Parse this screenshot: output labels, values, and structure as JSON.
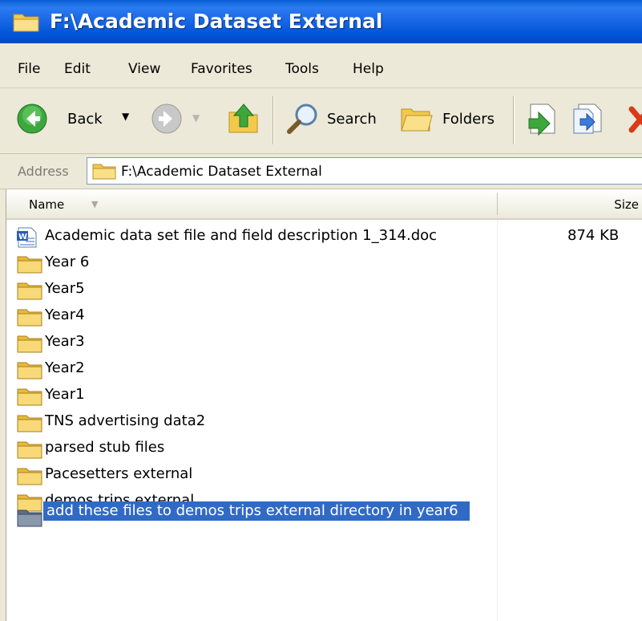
{
  "window": {
    "title": "F:\\Academic Dataset External",
    "icon": "folder-icon"
  },
  "menu": {
    "items": [
      "File",
      "Edit",
      "View",
      "Favorites",
      "Tools",
      "Help"
    ]
  },
  "toolbar": {
    "back_label": "Back",
    "search_label": "Search",
    "folders_label": "Folders",
    "icons": [
      "back-arrow-icon",
      "forward-arrow-icon",
      "up-folder-icon",
      "search-icon",
      "folders-icon",
      "move-to-icon",
      "copy-to-icon",
      "delete-icon"
    ]
  },
  "address": {
    "label": "Address",
    "value": "F:\\Academic Dataset External"
  },
  "list": {
    "columns": {
      "name": "Name",
      "size": "Size"
    },
    "items": [
      {
        "name": "Academic data set file and field description 1_314.doc",
        "size": "874 KB",
        "type": "word-doc"
      },
      {
        "name": "Year 6",
        "size": "",
        "type": "folder"
      },
      {
        "name": "Year5",
        "size": "",
        "type": "folder"
      },
      {
        "name": "Year4",
        "size": "",
        "type": "folder"
      },
      {
        "name": "Year3",
        "size": "",
        "type": "folder"
      },
      {
        "name": "Year2",
        "size": "",
        "type": "folder"
      },
      {
        "name": "Year1",
        "size": "",
        "type": "folder"
      },
      {
        "name": "TNS advertising data2",
        "size": "",
        "type": "folder"
      },
      {
        "name": "parsed stub files",
        "size": "",
        "type": "folder"
      },
      {
        "name": "Pacesetters external",
        "size": "",
        "type": "folder"
      },
      {
        "name": "demos trips external",
        "size": "",
        "type": "folder"
      },
      {
        "name": "add these files to demos trips external directory in year6",
        "size": "",
        "type": "folder",
        "selected": true
      }
    ]
  },
  "colors": {
    "titlebar": "#0054d8",
    "selection": "#316ac5",
    "chrome": "#ece9d8"
  }
}
